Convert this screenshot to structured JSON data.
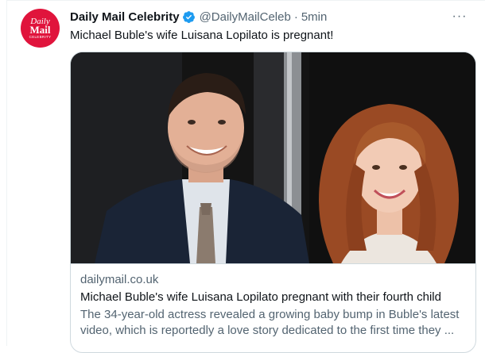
{
  "tweet": {
    "avatar": {
      "line1": "Daily",
      "line2": "Mail",
      "line3": "CELEBRITY",
      "bg_color": "#e0143c"
    },
    "display_name": "Daily Mail Celebrity",
    "verified": true,
    "verified_icon": "verified-badge-icon",
    "verified_color": "#1d9bf0",
    "handle": "@DailyMailCeleb",
    "separator": "·",
    "time": "5min",
    "more_icon": "more-horizontal-icon",
    "more_label": "···",
    "text": "Michael Buble's wife Luisana Lopilato is pregnant!",
    "card": {
      "image_description": "photo-of-couple",
      "domain": "dailymail.co.uk",
      "title": "Michael Buble's wife Luisana Lopilato pregnant with their fourth child",
      "description": "The 34-year-old actress revealed a growing baby bump in Buble's latest video, which is reportedly a love story dedicated to the first time they ..."
    }
  }
}
